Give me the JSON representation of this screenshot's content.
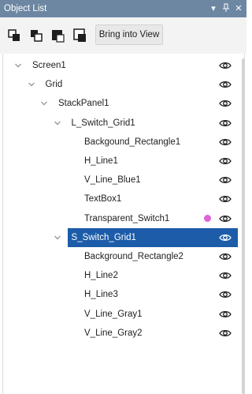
{
  "window": {
    "title": "Object List",
    "controls": {
      "dropdown_icon": "chevron-down-icon",
      "pin_icon": "pin-icon",
      "close_icon": "close-icon",
      "dropdown_glyph": "▾",
      "pin_glyph": "ᵖ",
      "close_glyph": "✕"
    }
  },
  "toolbar": {
    "buttons": [
      {
        "name": "bring-forward-icon"
      },
      {
        "name": "send-backward-icon"
      },
      {
        "name": "bring-to-front-icon"
      },
      {
        "name": "send-to-back-icon"
      }
    ],
    "bring_into_view_label": "Bring into View"
  },
  "colors": {
    "title_bar": "#6d87a3",
    "selection": "#1c5ca8",
    "marker_dot": "#d966d6"
  },
  "tree": {
    "items": [
      {
        "label": "Screen1",
        "depth": 0,
        "expandable": true,
        "expanded": true,
        "selected": false,
        "marker": false
      },
      {
        "label": "Grid",
        "depth": 1,
        "expandable": true,
        "expanded": true,
        "selected": false,
        "marker": false
      },
      {
        "label": "StackPanel1",
        "depth": 2,
        "expandable": true,
        "expanded": true,
        "selected": false,
        "marker": false
      },
      {
        "label": "L_Switch_Grid1",
        "depth": 3,
        "expandable": true,
        "expanded": true,
        "selected": false,
        "marker": false
      },
      {
        "label": "Backgound_Rectangle1",
        "depth": 4,
        "expandable": false,
        "expanded": false,
        "selected": false,
        "marker": false
      },
      {
        "label": "H_Line1",
        "depth": 4,
        "expandable": false,
        "expanded": false,
        "selected": false,
        "marker": false
      },
      {
        "label": "V_Line_Blue1",
        "depth": 4,
        "expandable": false,
        "expanded": false,
        "selected": false,
        "marker": false
      },
      {
        "label": "TextBox1",
        "depth": 4,
        "expandable": false,
        "expanded": false,
        "selected": false,
        "marker": false
      },
      {
        "label": "Transparent_Switch1",
        "depth": 4,
        "expandable": false,
        "expanded": false,
        "selected": false,
        "marker": true
      },
      {
        "label": "S_Switch_Grid1",
        "depth": 3,
        "expandable": true,
        "expanded": true,
        "selected": true,
        "marker": false
      },
      {
        "label": "Background_Rectangle2",
        "depth": 4,
        "expandable": false,
        "expanded": false,
        "selected": false,
        "marker": false
      },
      {
        "label": "H_Line2",
        "depth": 4,
        "expandable": false,
        "expanded": false,
        "selected": false,
        "marker": false
      },
      {
        "label": "H_Line3",
        "depth": 4,
        "expandable": false,
        "expanded": false,
        "selected": false,
        "marker": false
      },
      {
        "label": "V_Line_Gray1",
        "depth": 4,
        "expandable": false,
        "expanded": false,
        "selected": false,
        "marker": false
      },
      {
        "label": "V_Line_Gray2",
        "depth": 4,
        "expandable": false,
        "expanded": false,
        "selected": false,
        "marker": false
      }
    ],
    "visibility_icon": "eye-icon"
  }
}
